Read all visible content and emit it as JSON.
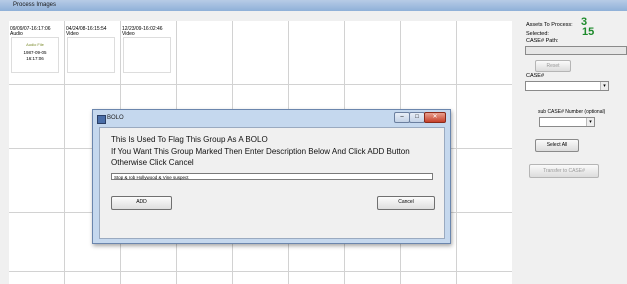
{
  "window": {
    "title": "Process Images"
  },
  "thumbnails": [
    {
      "caption_line1": "09/09/07-16:17:06",
      "caption_line2": "Audio",
      "audio_label": "Audio File",
      "audio_date_line1": "1987-09-05",
      "audio_date_line2": "16:17:06"
    },
    {
      "caption_line1": "04/24/08-16:15:54",
      "caption_line2": "Video"
    },
    {
      "caption_line1": "12/23/09-16:02:46",
      "caption_line2": "Video"
    }
  ],
  "panel": {
    "assets_to_process_label": "Assets To Process:",
    "assets_to_process_value": "3",
    "selected_label": "Selected:",
    "selected_value": "15",
    "case_path_label": "CASE# Path:",
    "case_path_value": "",
    "reset_button": "Reset",
    "case_label": "CASE#",
    "case_value": "",
    "sub_case_label": "sub CASE# Number (optional)",
    "sub_case_value": "",
    "select_all_button": "Select All",
    "transfer_button": "Transfer to CASE#"
  },
  "dialog": {
    "title": "BOLO",
    "line1": "This Is Used To Flag This Group As A BOLO",
    "line2": "If You Want This Group Marked Then Enter Description Below And Click ADD Button",
    "line3": "Otherwise Click Cancel",
    "description_value": "Stop & rob Hollywood & Vine suspect",
    "add_button": "ADD",
    "cancel_button": "Cancel",
    "minimize_glyph": "–",
    "maximize_glyph": "□",
    "close_glyph": "✕"
  },
  "colors": {
    "count_green": "#1d8a2b",
    "dialog_frame": "#c5d8ee",
    "close_red": "#c6402a"
  }
}
